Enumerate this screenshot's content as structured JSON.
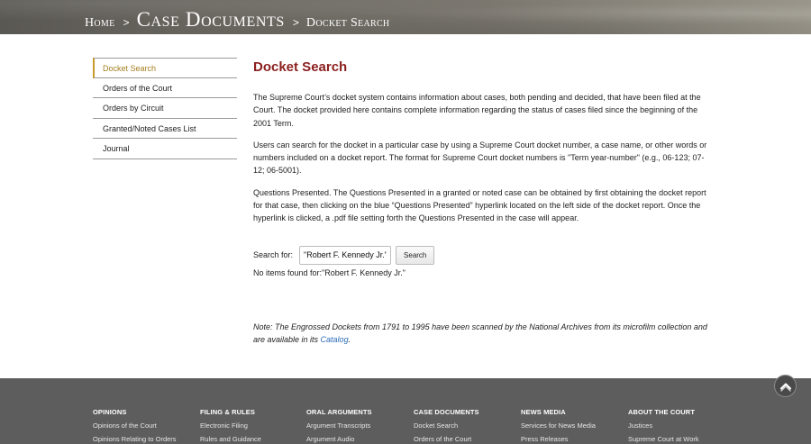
{
  "breadcrumb": {
    "home": "Home",
    "sep1": ">",
    "section": "Case Documents",
    "sep2": ">",
    "current": "Docket Search"
  },
  "sidebar": {
    "items": [
      {
        "label": "Docket Search",
        "active": true
      },
      {
        "label": "Orders of the Court"
      },
      {
        "label": "Orders by Circuit"
      },
      {
        "label": "Granted/Noted Cases List"
      },
      {
        "label": "Journal"
      }
    ]
  },
  "main": {
    "title": "Docket Search",
    "paragraphs": [
      "The Supreme Court’s docket system contains information about cases, both pending and decided, that have been filed at the Court. The docket provided here contains complete information regarding the status of cases filed since the beginning of the 2001 Term.",
      "Users can search for the docket in a particular case by using a Supreme Court docket number, a case name, or other words or numbers included on a docket report. The format for Supreme Court docket numbers is \"Term year-number\" (e.g., 06-123; 07-12; 06-5001).",
      "Questions Presented. The Questions Presented in a granted or noted case can be obtained by first obtaining the docket report for that case, then clicking on the blue “Questions Presented” hyperlink located on the left side of the docket report. Once the hyperlink is clicked, a .pdf file setting forth the Questions Presented in the case will appear."
    ],
    "search": {
      "label": "Search for:",
      "value": "\"Robert F. Kennedy Jr.\"",
      "button": "Search"
    },
    "no_items": "No items found for:\"Robert F. Kennedy Jr.\"",
    "note_text": "Note: The Engrossed Dockets from 1791 to 1995 have been scanned by the National Archives from its microfilm collection and are available in its ",
    "note_link": "Catalog",
    "note_end": "."
  },
  "footer": {
    "columns": [
      {
        "heading": "OPINIONS",
        "links": [
          "Opinions of the Court",
          "Opinions Relating to Orders"
        ]
      },
      {
        "heading": "FILING & RULES",
        "links": [
          "Electronic Filing",
          "Rules and Guidance"
        ]
      },
      {
        "heading": "ORAL ARGUMENTS",
        "links": [
          "Argument Transcripts",
          "Argument Audio"
        ]
      },
      {
        "heading": "CASE DOCUMENTS",
        "links": [
          "Docket Search",
          "Orders of the Court"
        ]
      },
      {
        "heading": "NEWS MEDIA",
        "links": [
          "Services for News Media",
          "Press Releases"
        ]
      },
      {
        "heading": "ABOUT THE COURT",
        "links": [
          "Justices",
          "Supreme Court at Work"
        ]
      }
    ]
  },
  "icons": {
    "back_to_top": "chevron-up-icon"
  }
}
